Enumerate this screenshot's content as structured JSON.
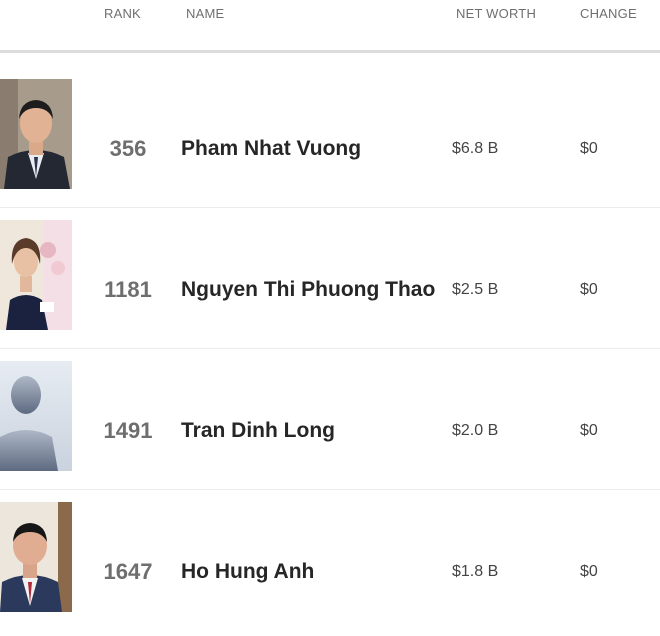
{
  "header": {
    "rank": "RANK",
    "name": "NAME",
    "net_worth": "NET WORTH",
    "change": "CHANGE"
  },
  "rows": [
    {
      "rank": "356",
      "name": "Pham Nhat Vuong",
      "net_worth": "$6.8 B",
      "change": "$0"
    },
    {
      "rank": "1181",
      "name": "Nguyen Thi Phuong Thao",
      "net_worth": "$2.5 B",
      "change": "$0"
    },
    {
      "rank": "1491",
      "name": "Tran Dinh Long",
      "net_worth": "$2.0 B",
      "change": "$0"
    },
    {
      "rank": "1647",
      "name": "Ho Hung Anh",
      "net_worth": "$1.8 B",
      "change": "$0"
    }
  ],
  "colors": {
    "header_text": "#6f6f6f",
    "rank_text": "#6e6e6e",
    "name_text": "#262626",
    "divider": "#dcdcdc"
  }
}
